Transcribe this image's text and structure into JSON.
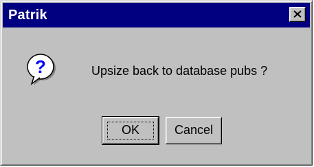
{
  "window": {
    "title": "Patrik",
    "close_icon": "close-icon"
  },
  "message": {
    "icon": "question-icon",
    "text": "Upsize back to database pubs ?"
  },
  "buttons": {
    "ok_label": "OK",
    "cancel_label": "Cancel"
  },
  "colors": {
    "titlebar": "#000080",
    "title_text": "#ffffff",
    "dialog_bg": "#c0c0c0",
    "icon_bubble": "#ffffff",
    "icon_mark": "#0000ff"
  }
}
